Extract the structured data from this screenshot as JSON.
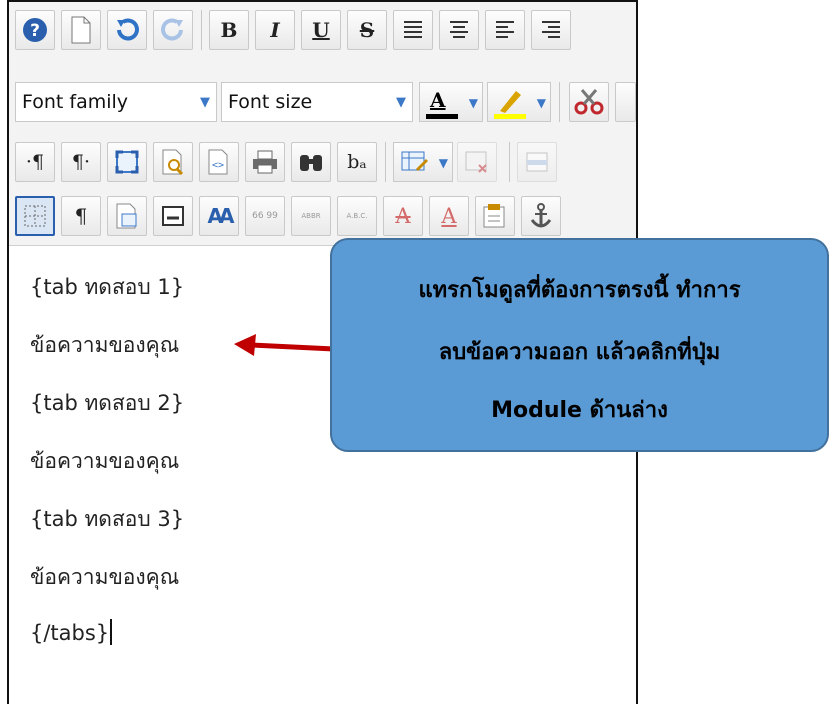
{
  "toolbar": {
    "row1": {
      "help_icon": "help-icon",
      "bold_label": "B",
      "italic_label": "I",
      "underline_label": "U",
      "strike_label": "S"
    },
    "row2": {
      "font_family_label": "Font family",
      "font_size_label": "Font size",
      "font_color_label": "A",
      "font_color": "#000000",
      "highlight_color": "#ffff00"
    },
    "row3": {
      "pilcrow_ltr": "·¶",
      "pilcrow_rtl": "¶·",
      "ba_label": "bₐ"
    },
    "row4": {
      "pilcrow": "¶",
      "font_style_label": "AA",
      "quote_label": "66 99",
      "abbr_label": "ABBR",
      "acronym_label": "A.B.C.",
      "strike_a": "A",
      "ins_a": "A"
    }
  },
  "content": {
    "lines": [
      "{tab ทดสอบ 1}",
      "ข้อความของคุณ",
      "{tab ทดสอบ 2}",
      "ข้อความของคุณ",
      "{tab ทดสอบ 3}",
      "ข้อความของคุณ",
      "{/tabs}"
    ]
  },
  "callout": {
    "line1": "แทรกโมดูลที่ต้องการตรงนี้ ทำการ",
    "line2": "ลบข้อความออก แล้วคลิกที่ปุ่ม",
    "line3": "Module ด้านล่าง",
    "fill_color": "#5b9bd5",
    "arrow_color": "#c00000"
  }
}
